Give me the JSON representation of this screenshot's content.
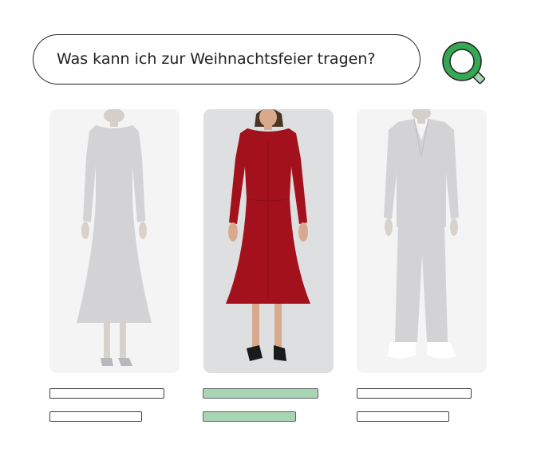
{
  "search": {
    "query": "Was kann ich zur Weihnachtsfeier tragen?",
    "button_icon": "search-icon"
  },
  "colors": {
    "accent_green": "#34a853",
    "selected_bar": "#a8d5b2",
    "dress_red": "#a3111d",
    "faded_garment": "#d3d3d5"
  },
  "results": [
    {
      "garment": "dress",
      "selected": false
    },
    {
      "garment": "dress",
      "selected": true
    },
    {
      "garment": "suit",
      "selected": false
    }
  ]
}
